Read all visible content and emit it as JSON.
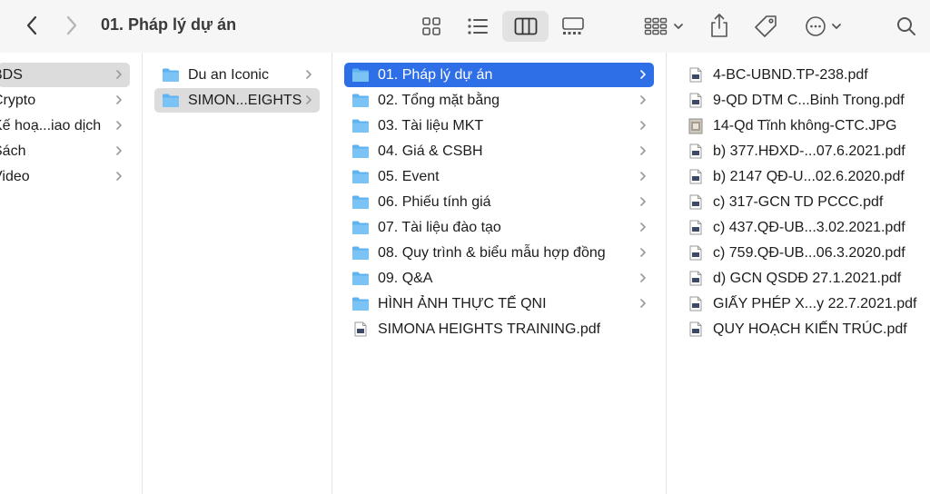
{
  "window": {
    "title": "01. Pháp lý dự án"
  },
  "colors": {
    "selection_blue": "#2e6ee6",
    "selection_gray": "#dcdcdc",
    "folder_blue": "#5fb3f0",
    "toolbar_bg": "#f6f6f6"
  },
  "toolbar": {
    "icons": [
      "chevron-left-icon",
      "chevron-right-icon",
      "grid-icon",
      "list-icon",
      "columns-icon",
      "gallery-icon",
      "group-icon",
      "share-icon",
      "tag-icon",
      "more-icon",
      "search-icon"
    ],
    "active_view": "columns"
  },
  "column1": {
    "items": [
      {
        "label": "BDS",
        "selected": true
      },
      {
        "label": "Crypto"
      },
      {
        "label": "Kế hoạ...iao dịch"
      },
      {
        "label": "Sách"
      },
      {
        "label": "Video"
      }
    ]
  },
  "column2": {
    "items": [
      {
        "label": "Du an Iconic"
      },
      {
        "label": "SIMON...EIGHTS",
        "selected": true
      }
    ]
  },
  "column3": {
    "items": [
      {
        "label": "01. Pháp lý dự án",
        "selected": true
      },
      {
        "label": "02. Tổng mặt bằng"
      },
      {
        "label": "03. Tài liệu MKT"
      },
      {
        "label": "04. Giá & CSBH"
      },
      {
        "label": "05. Event"
      },
      {
        "label": "06. Phiếu tính giá"
      },
      {
        "label": "07. Tài liệu đào tạo"
      },
      {
        "label": "08. Quy trình & biểu mẫu hợp đồng"
      },
      {
        "label": "09. Q&A"
      },
      {
        "label": "HÌNH ẢNH THỰC TẾ QNI"
      },
      {
        "label": "SIMONA HEIGHTS TRAINING.pdf"
      }
    ]
  },
  "column4": {
    "items": [
      {
        "label": "4-BC-UBND.TP-238.pdf"
      },
      {
        "label": "9-QD DTM C...Binh Trong.pdf"
      },
      {
        "label": "14-Qd Tĩnh không-CTC.JPG"
      },
      {
        "label": "b) 377.HĐXD-...07.6.2021.pdf"
      },
      {
        "label": "b) 2147 QĐ-U...02.6.2020.pdf"
      },
      {
        "label": "c) 317-GCN TD PCCC.pdf"
      },
      {
        "label": "c) 437.QĐ-UB...3.02.2021.pdf"
      },
      {
        "label": "c) 759.QĐ-UB...06.3.2020.pdf"
      },
      {
        "label": "d) GCN QSDĐ 27.1.2021.pdf"
      },
      {
        "label": "GIẤY PHÉP X...y 22.7.2021.pdf"
      },
      {
        "label": "QUY HOẠCH KIẾN TRÚC.pdf"
      }
    ]
  }
}
